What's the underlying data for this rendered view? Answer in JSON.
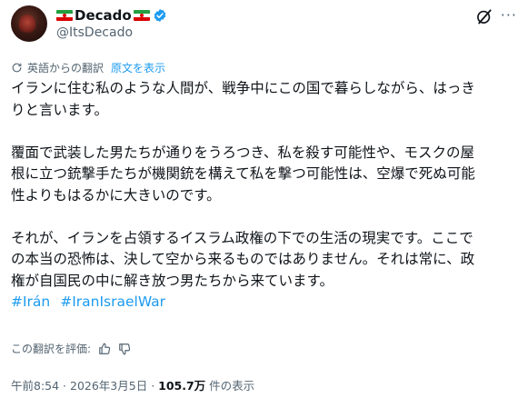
{
  "author": {
    "display_name": "Decado",
    "handle": "@ItsDecado",
    "verified_icon": "verified-badge-icon",
    "flag_icon": "iran-flag-icon"
  },
  "translation": {
    "label": "英語からの翻訳",
    "show_original": "原文を表示"
  },
  "tweet": {
    "lines": [
      "イランに住む私のような人間が、戦争中にこの国で暮らしながら、はっき",
      "りと言います。",
      "",
      "覆面で武装した男たちが通りをうろつき、私を殺す可能性や、モスクの屋",
      "根に立つ銃撃手たちが機関銃を構えて私を撃つ可能性は、空爆で死ぬ可能",
      "性よりもはるかに大きいのです。",
      "",
      "それが、イランを占領するイスラム政権の下での生活の現実です。ここで",
      "の本当の恐怖は、決して空から来るものではありません。それは常に、政",
      "権が自国民の中に解き放つ男たちから来ています。"
    ],
    "hashtags": [
      "#Irán",
      "#IranIsraelWar"
    ]
  },
  "rating": {
    "label": "この翻訳を評価:"
  },
  "meta": {
    "time": "午前8:54",
    "separator": " · ",
    "date": "2026年3月5日",
    "views_count": "105.7万",
    "views_label": " 件の表示"
  },
  "colors": {
    "link": "#1d9bf0",
    "secondary_text": "#536471",
    "primary_text": "#0f1419"
  }
}
